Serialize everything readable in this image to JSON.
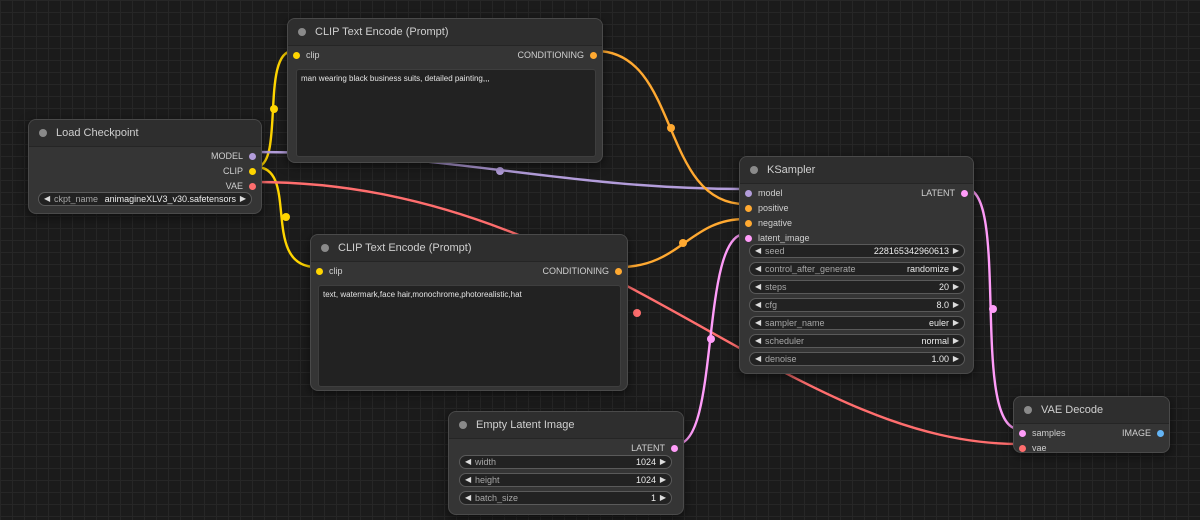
{
  "colors": {
    "background": "#1b1b1b",
    "node_body": "#353535",
    "node_title": "#2e2e2e",
    "wire_clip": "#ffd500",
    "wire_conditioning": "#ffa931",
    "wire_model": "#b39ddb",
    "wire_vae": "#ff6e6e",
    "wire_latent": "#ff9cf9",
    "image_slot": "#64b5f6"
  },
  "nodes": {
    "load_checkpoint": {
      "title": "Load Checkpoint",
      "outputs": {
        "model": "MODEL",
        "clip": "CLIP",
        "vae": "VAE"
      },
      "ckpt": {
        "label": "ckpt_name",
        "value": "animagineXLV3_v30.safetensors"
      }
    },
    "clip_positive": {
      "title": "CLIP Text Encode (Prompt)",
      "input": "clip",
      "output": "CONDITIONING",
      "text": "man wearing black business suits, detailed painting,,,"
    },
    "clip_negative": {
      "title": "CLIP Text Encode (Prompt)",
      "input": "clip",
      "output": "CONDITIONING",
      "text": "text, watermark,face hair,monochrome,photorealistic,hat"
    },
    "ksampler": {
      "title": "KSampler",
      "inputs": {
        "model": "model",
        "positive": "positive",
        "negative": "negative",
        "latent_image": "latent_image"
      },
      "output": "LATENT",
      "widgets": [
        {
          "label": "seed",
          "value": "228165342960613"
        },
        {
          "label": "control_after_generate",
          "value": "randomize"
        },
        {
          "label": "steps",
          "value": "20"
        },
        {
          "label": "cfg",
          "value": "8.0"
        },
        {
          "label": "sampler_name",
          "value": "euler"
        },
        {
          "label": "scheduler",
          "value": "normal"
        },
        {
          "label": "denoise",
          "value": "1.00"
        }
      ]
    },
    "empty_latent": {
      "title": "Empty Latent Image",
      "output": "LATENT",
      "widgets": [
        {
          "label": "width",
          "value": "1024"
        },
        {
          "label": "height",
          "value": "1024"
        },
        {
          "label": "batch_size",
          "value": "1"
        }
      ]
    },
    "vae_decode": {
      "title": "VAE Decode",
      "inputs": {
        "samples": "samples",
        "vae": "vae"
      },
      "output": "IMAGE"
    }
  }
}
